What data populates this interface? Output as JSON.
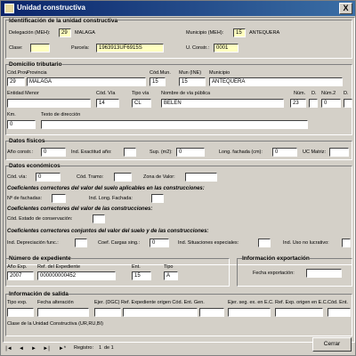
{
  "window": {
    "title": "Unidad constructiva",
    "close_label": "X"
  },
  "ident": {
    "title": "Identificación de la unidad constructiva",
    "delegacion_label": "Delegación (MEH):",
    "delegacion_code": "29",
    "delegacion_name": "MALAGA",
    "municipio_label": "Municipio (MEH):",
    "municipio_code": "15",
    "municipio_name": "ANTEQUERA",
    "clase_label": "Clase:",
    "clase_value": "",
    "parcela_label": "Parcela:",
    "parcela_value": "1963913UF6915S",
    "uconstr_label": "U. Constr.:",
    "uconstr_value": "0001"
  },
  "domicilio": {
    "title": "Domicilio tributario",
    "cod_prov_label": "Cód.Prov",
    "provincia_label": "Provincia",
    "cod_mun_label": "Cód.Mun.",
    "mun_ine_label": "Mun (INE)",
    "municipio_label": "Municipio",
    "cod_prov": "29",
    "provincia": "MALAGA",
    "cod_mun": "15",
    "mun_ine": "15",
    "municipio": "ANTEQUERA",
    "entidad_menor_label": "Entidad Menor",
    "cod_via_label": "Cód. Vía",
    "tipo_via_label": "Tipo vía",
    "nombre_via_label": "Nombre de vía pública",
    "num_label": "Núm.",
    "d_label": "D.",
    "num2_label": "Núm.2",
    "d2_label": "D.",
    "entidad_menor": "",
    "cod_via": "14",
    "tipo_via": "CL",
    "nombre_via": "BELEN",
    "num": "23",
    "d": "",
    "num2": "0",
    "d2": "",
    "km_label": "Km.",
    "texto_dir_label": "Texto de dirección",
    "km": "0",
    "texto_dir": ""
  },
  "fisicos": {
    "title": "Datos físicos",
    "anio_label": "Año constr.:",
    "anio": "0",
    "exactitud_label": "Ind. Exactitud año:",
    "exactitud": "",
    "sup_label": "Sup. (m2):",
    "sup": "0",
    "long_label": "Long. fachada (cm):",
    "long": "0",
    "uc_label": "UC Matriz:",
    "uc": ""
  },
  "economicos": {
    "title": "Datos económicos",
    "cod_via_label": "Cód. vía:",
    "cod_via": "0",
    "cod_tramo_label": "Cód. Tramo:",
    "cod_tramo": "",
    "zona_label": "Zona de Valor:",
    "zona": "",
    "coef_suelo_title": "Coeficientes correctores del valor del suelo aplicables en las construcciones:",
    "fachadas_label": "Nº de fachadas:",
    "fachadas": "",
    "long_fachada_label": "Ind. Long. Fachada:",
    "long_fachada": "",
    "coef_constr_title": "Coeficientes correctores del valor de las construcciones:",
    "conservacion_label": "Cód. Estado de conservación:",
    "conservacion": "",
    "coef_conj_title": "Coeficientes correctores conjuntos del valor del suelo y de las construcciones:",
    "depreciacion_label": "Ind. Depreciación func.:",
    "depreciacion": "",
    "cargas_label": "Coef. Cargas sing.:",
    "cargas": "0",
    "situaciones_label": "Ind. Situaciones especiales:",
    "situaciones": "",
    "uso_label": "Ind. Uso no lucrativo:",
    "uso": ""
  },
  "expediente": {
    "title": "Número de expediente",
    "anio_label": "Año Exp.",
    "ref_label": "Ref. del Expediente",
    "ent_label": "Ent.",
    "tipo_label": "Tipo",
    "anio": "2007",
    "ref": "000000000452",
    "ent": "15",
    "tipo": "A"
  },
  "exportacion": {
    "title": "Información exportación",
    "fecha_label": "Fecha exportación:",
    "fecha": ""
  },
  "salida": {
    "title": "Información de salida",
    "tipo_exp_label": "Tipo exp.",
    "fecha_alt_label": "Fecha alteración",
    "ejer_label": "Ejer. (DGC) Ref. Expediente origen Cód. Ent. Gen.",
    "ejer_seg_label": "Ejer. seg. ex. en E.C.",
    "ref_exp_label": "Ref. Exp. origen en E.C.",
    "cod_ent_label": "Cód. Ent.",
    "clase_label": "Clase de la Unidad Constructiva (UR,RU,BI)"
  },
  "footer": {
    "first": "|◄",
    "prev": "◄",
    "next": "►",
    "last": "►|",
    "new": "►*",
    "record_label": "Registro:",
    "record_num": "1",
    "record_of": "de 1",
    "close_button": "Cerrar"
  },
  "colors": {
    "title_start": "#0a246a",
    "title_end": "#3a6ea5",
    "highlight_field": "#ffffc0"
  }
}
